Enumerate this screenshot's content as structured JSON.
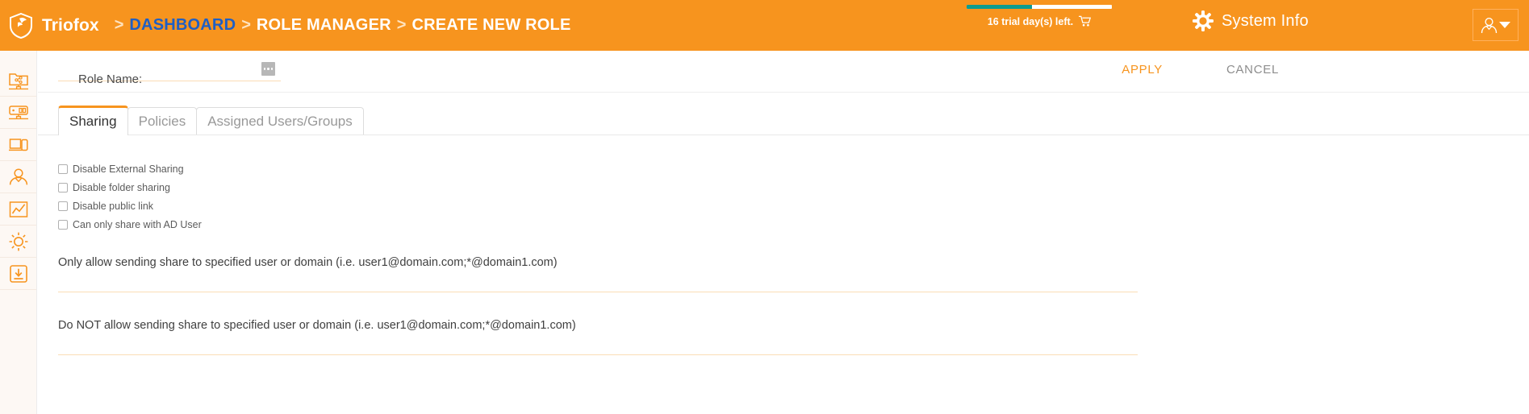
{
  "header": {
    "brand": "Triofox",
    "logo_icon": "shield-icon",
    "breadcrumbs": [
      {
        "label": "DASHBOARD",
        "is_link": true
      },
      {
        "label": "ROLE MANAGER",
        "is_link": false
      },
      {
        "label": "CREATE NEW ROLE",
        "is_link": false
      }
    ],
    "separator": ">",
    "trial": {
      "text": "16 trial day(s) left.",
      "cart_icon": "shopping-cart-icon",
      "progress_percent": 45,
      "bar_fill_color": "#0e9c8e",
      "bar_track_color": "#ffffff"
    },
    "system_info": {
      "label": "System Info",
      "icon": "gear-icon"
    },
    "user_menu": {
      "icon": "user-icon",
      "caret": "chevron-down-icon"
    },
    "background_color": "#f7941e",
    "link_color": "#1f5fc4"
  },
  "sidebar": {
    "items": [
      {
        "name": "shared-folder",
        "icon": "shared-folder-icon"
      },
      {
        "name": "server",
        "icon": "server-icon"
      },
      {
        "name": "devices",
        "icon": "devices-icon"
      },
      {
        "name": "users",
        "icon": "user-profile-icon"
      },
      {
        "name": "reports",
        "icon": "line-chart-icon"
      },
      {
        "name": "settings",
        "icon": "gear-icon"
      },
      {
        "name": "downloads",
        "icon": "download-icon"
      }
    ]
  },
  "role_form": {
    "role_name_label": "Role Name:",
    "role_name_value": "",
    "role_name_placeholder": "",
    "more_button_icon": "ellipsis-icon",
    "apply_label": "APPLY",
    "cancel_label": "CANCEL",
    "apply_color": "#f7941e",
    "cancel_color": "#8d8d8d"
  },
  "tabs": [
    {
      "label": "Sharing",
      "active": true
    },
    {
      "label": "Policies",
      "active": false
    },
    {
      "label": "Assigned Users/Groups",
      "active": false
    }
  ],
  "sharing_panel": {
    "checkboxes": [
      {
        "label": "Disable External Sharing",
        "checked": false
      },
      {
        "label": "Disable folder sharing",
        "checked": false
      },
      {
        "label": "Disable public link",
        "checked": false
      },
      {
        "label": "Can only share with AD User",
        "checked": false
      }
    ],
    "fields": [
      {
        "caption": "Only allow sending share to specified user or domain (i.e. user1@domain.com;*@domain1.com)",
        "value": "",
        "placeholder": ""
      },
      {
        "caption": "Do NOT allow sending share to specified user or domain (i.e. user1@domain.com;*@domain1.com)",
        "value": "",
        "placeholder": ""
      }
    ]
  }
}
